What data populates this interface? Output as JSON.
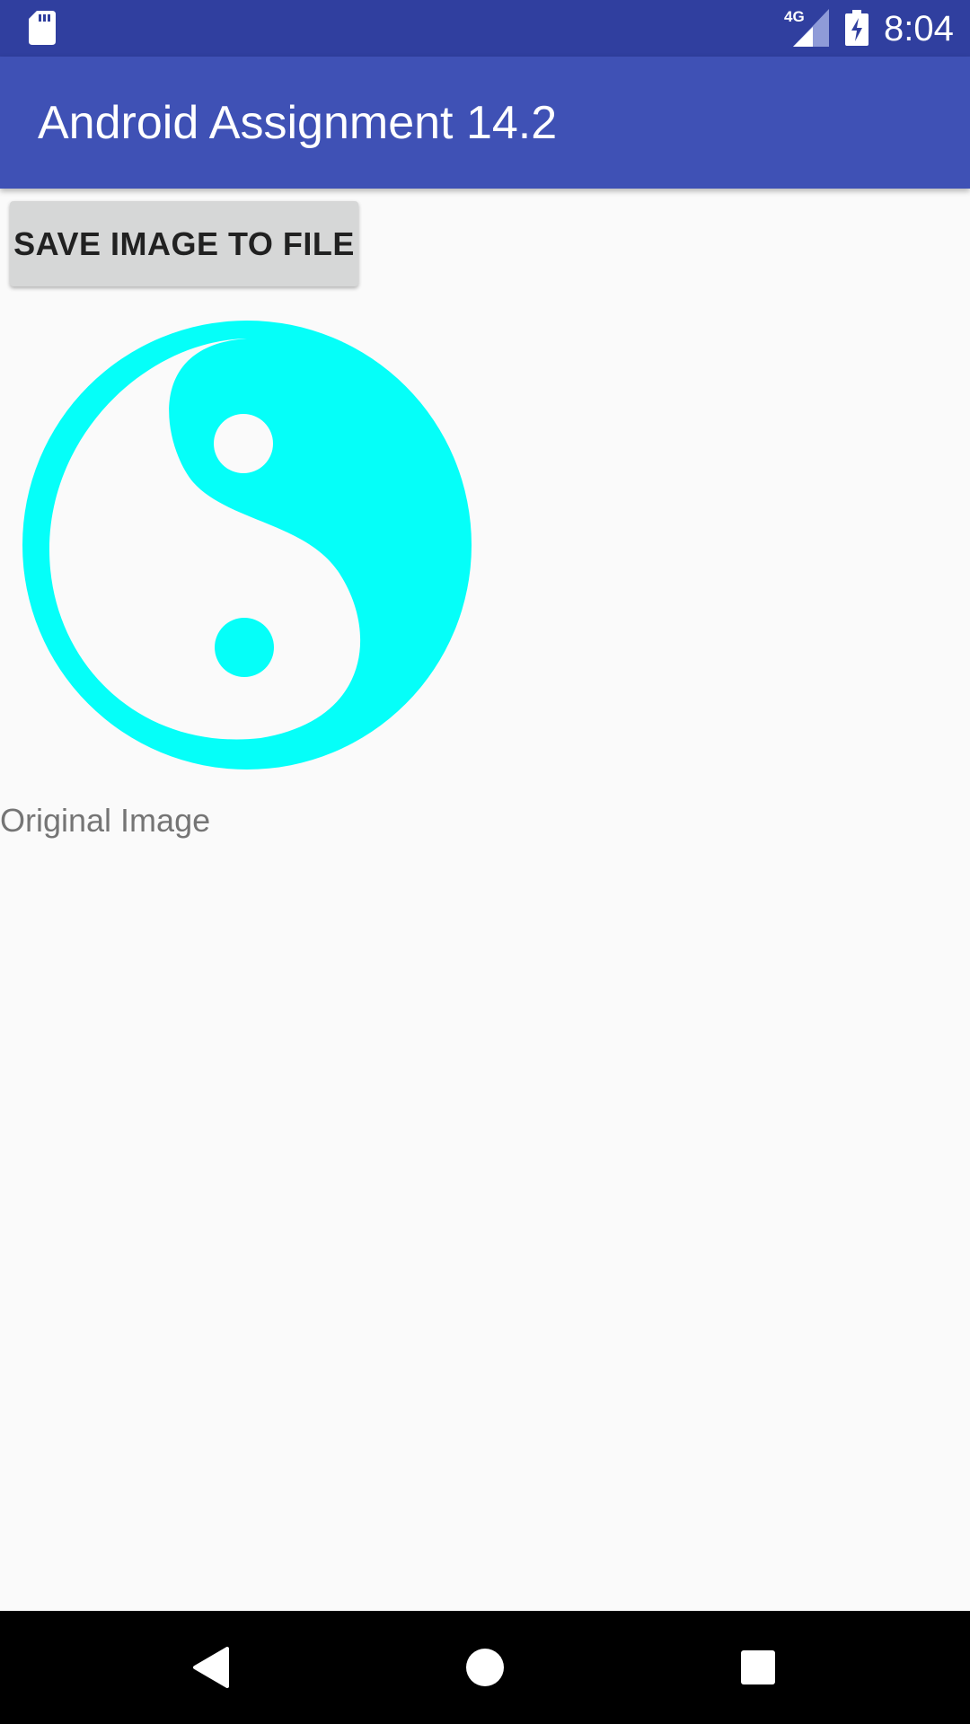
{
  "status_bar": {
    "time": "8:04",
    "network_label": "4G",
    "icons": [
      "sd-card-icon",
      "signal-4g-icon",
      "battery-charging-icon"
    ]
  },
  "app_bar": {
    "title": "Android Assignment 14.2"
  },
  "main": {
    "save_button_label": "SAVE IMAGE TO FILE",
    "image": {
      "icon": "yin-yang-icon",
      "color": "#05fff9"
    },
    "caption": "Original Image"
  },
  "nav_bar": {
    "icons": [
      "back-icon",
      "home-icon",
      "recents-icon"
    ]
  },
  "colors": {
    "status_bar": "#303f9f",
    "app_bar": "#3f51b5",
    "background": "#fafafa",
    "button": "#d6d7d7",
    "accent_image": "#05fff9"
  }
}
